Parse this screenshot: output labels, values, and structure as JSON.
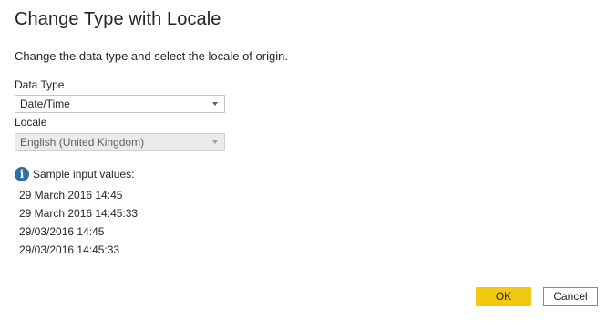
{
  "dialog": {
    "title": "Change Type with Locale",
    "description": "Change the data type and select the locale of origin."
  },
  "data_type": {
    "label": "Data Type",
    "selected": "Date/Time"
  },
  "locale": {
    "label": "Locale",
    "selected": "English (United Kingdom)"
  },
  "samples": {
    "header": "Sample input values:",
    "values": [
      "29 March 2016 14:45",
      "29 March 2016 14:45:33",
      "29/03/2016 14:45",
      "29/03/2016 14:45:33"
    ]
  },
  "buttons": {
    "ok_label": "OK",
    "cancel_label": "Cancel"
  },
  "colors": {
    "accent": "#f2c811",
    "info_icon": "#2f6fa6"
  },
  "icons": {
    "info": "info-icon",
    "dropdown": "chevron-down-icon"
  }
}
